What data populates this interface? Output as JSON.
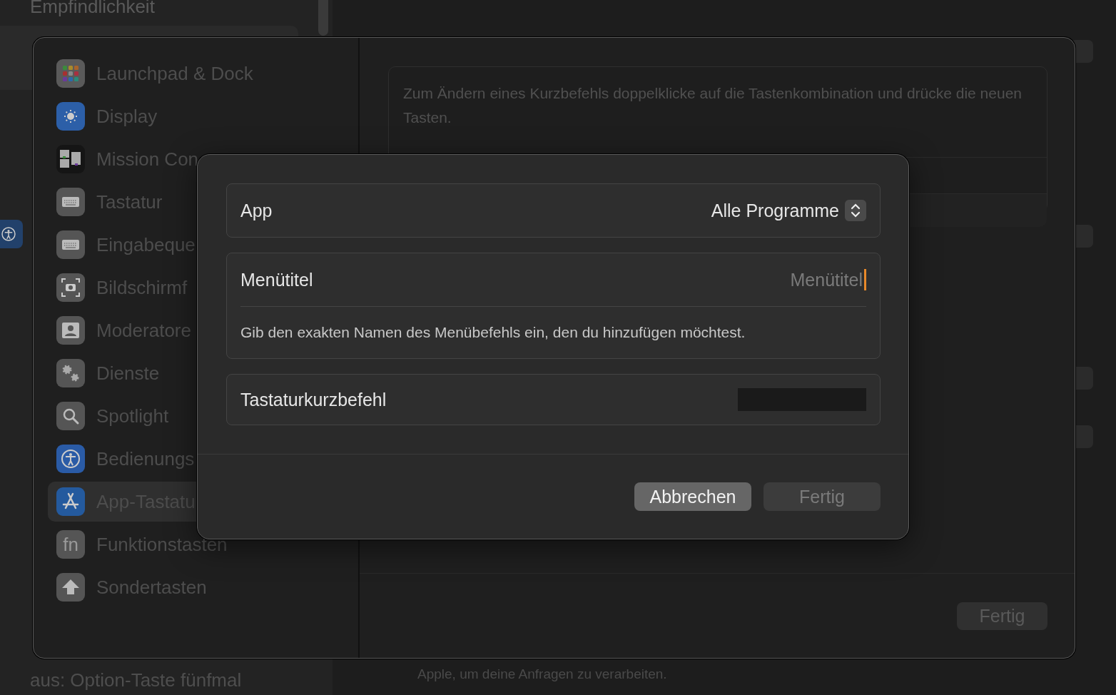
{
  "background_window": {
    "sidebar_items": [
      {
        "label": "Empfindlichkeit"
      }
    ],
    "footer_text": "aus: Option-Taste fünfmal",
    "content_text": "Apple, um deine Anfragen zu verarbeiten."
  },
  "sheet": {
    "sidebar": {
      "items": [
        {
          "label": "Launchpad & Dock",
          "kind": "launchpad",
          "selected": false
        },
        {
          "label": "Display",
          "kind": "display",
          "selected": false
        },
        {
          "label": "Mission Con",
          "kind": "mission",
          "selected": false
        },
        {
          "label": "Tastatur",
          "kind": "keyboard",
          "selected": false
        },
        {
          "label": "Eingabeque",
          "kind": "keyboard",
          "selected": false
        },
        {
          "label": "Bildschirmf",
          "kind": "screenshot",
          "selected": false
        },
        {
          "label": "Moderatore",
          "kind": "presenter",
          "selected": false
        },
        {
          "label": "Dienste",
          "kind": "gears",
          "selected": false
        },
        {
          "label": "Spotlight",
          "kind": "search",
          "selected": false
        },
        {
          "label": "Bedienungs",
          "kind": "accessibility",
          "selected": false
        },
        {
          "label": "App-Tastatu",
          "kind": "appstore",
          "selected": true
        },
        {
          "label": "Funktionstasten",
          "kind": "fn",
          "icon_text": "fn",
          "selected": false
        },
        {
          "label": "Sondertasten",
          "kind": "shift",
          "selected": false
        }
      ]
    },
    "info_text": "Zum Ändern eines Kurzbefehls doppelklicke auf die Tastenkombination und drücke die neuen Tasten.",
    "done_button": {
      "label": "Fertig"
    }
  },
  "dialog": {
    "app_row": {
      "label": "App",
      "value": "Alle Programme"
    },
    "menu_title": {
      "label": "Menütitel",
      "placeholder": "Menütitel",
      "hint": "Gib den exakten Namen des Menübefehls ein, den du hinzufügen möchtest."
    },
    "shortcut": {
      "label": "Tastaturkurzbefehl"
    },
    "buttons": [
      {
        "label": "Abbrechen",
        "kind": "cancel",
        "disabled": false
      },
      {
        "label": "Fertig",
        "kind": "done",
        "disabled": true
      }
    ]
  }
}
